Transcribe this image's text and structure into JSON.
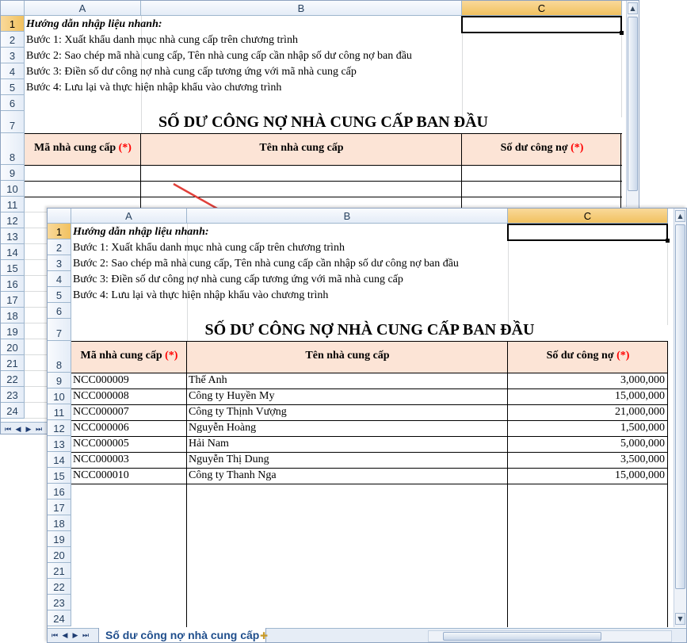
{
  "columns": [
    "A",
    "B",
    "C"
  ],
  "sheet_tab": "Số dư công nợ nhà cung cấp",
  "instructions": {
    "title": "Hướng dẫn nhập liệu nhanh:",
    "step1": "Bước 1: Xuất khẩu danh mục nhà cung cấp trên chương trình",
    "step2": "Bước 2: Sao chép mã nhà cung cấp, Tên nhà cung cấp cần nhập số dư công nợ ban đầu",
    "step3": "Bước 3: Điền số dư công nợ nhà cung cấp tương ứng với mã nhà cung cấp",
    "step4": "Bước 4: Lưu lại và thực hiện nhập khẩu vào chương trình"
  },
  "table_title": "SỐ DƯ CÔNG NỢ NHÀ CUNG CẤP BAN ĐẦU",
  "headers": {
    "code": "Mã nhà cung cấp",
    "name": "Tên nhà cung cấp",
    "balance": "Số dư công nợ",
    "required_mark": "(*)"
  },
  "rows": [
    {
      "code": "NCC000009",
      "name": "Thế Anh",
      "balance": "3,000,000"
    },
    {
      "code": "NCC000008",
      "name": "Công ty Huyền My",
      "balance": "15,000,000"
    },
    {
      "code": "NCC000007",
      "name": "Công ty Thịnh Vượng",
      "balance": "21,000,000"
    },
    {
      "code": "NCC000006",
      "name": "Nguyễn Hoàng",
      "balance": "1,500,000"
    },
    {
      "code": "NCC000005",
      "name": "Hải Nam",
      "balance": "5,000,000"
    },
    {
      "code": "NCC000003",
      "name": "Nguyễn Thị Dung",
      "balance": "3,500,000"
    },
    {
      "code": "NCC000010",
      "name": "Công ty Thanh Nga",
      "balance": "15,000,000"
    }
  ],
  "row_numbers_back": [
    "1",
    "2",
    "3",
    "4",
    "5",
    "6",
    "7",
    "8",
    "9",
    "10",
    "11",
    "12",
    "13",
    "14",
    "15",
    "16",
    "17",
    "18",
    "19",
    "20",
    "21",
    "22",
    "23",
    "24"
  ],
  "row_numbers_front": [
    "1",
    "2",
    "3",
    "4",
    "5",
    "6",
    "7",
    "8",
    "9",
    "10",
    "11",
    "12",
    "13",
    "14",
    "15",
    "16",
    "17",
    "18",
    "19",
    "20",
    "21",
    "22",
    "23",
    "24"
  ],
  "colors": {
    "header_fill": "#fce4d6",
    "required": "#ff0000",
    "arrow": "#e0403a",
    "selected_col": "#f1c15f"
  }
}
